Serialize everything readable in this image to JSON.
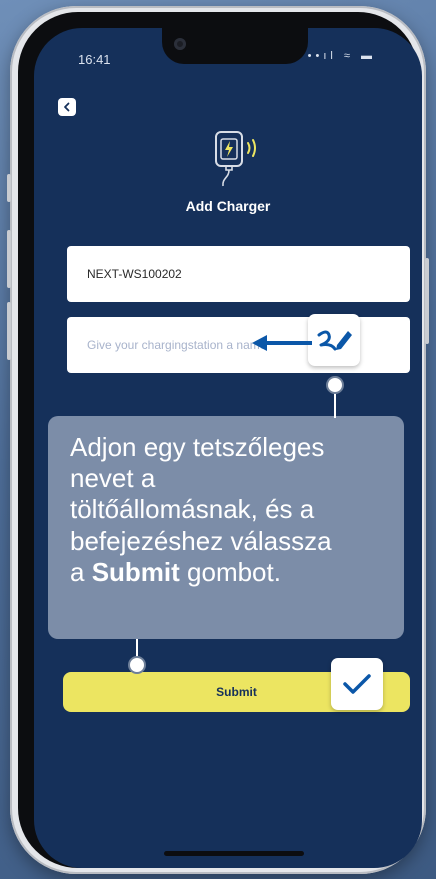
{
  "status_bar": {
    "time": "16:41",
    "icons": "••ıl ≈ ▬"
  },
  "header": {
    "title": "Add Charger"
  },
  "form": {
    "charger_id_value": "NEXT-WS100202",
    "name_placeholder": "Give your chargingstation a name",
    "submit_label": "Submit"
  },
  "tutorial": {
    "line1": "Adjon egy tetszőleges",
    "line2": "nevet a",
    "line3": "töltőállomásnak, és a",
    "line4": "befejezéshez válassza",
    "line5_pre": "a ",
    "line5_bold": "Submit",
    "line5_post": " gombot."
  },
  "colors": {
    "screen_bg": "#15305a",
    "accent_yellow": "#ece561",
    "callout_bg": "#8091aa",
    "arrow_blue": "#0b57a8"
  },
  "icons": [
    "back-chevron-icon",
    "wireless-charger-icon",
    "pen-icon",
    "checkmark-icon",
    "arrow-left-icon"
  ]
}
